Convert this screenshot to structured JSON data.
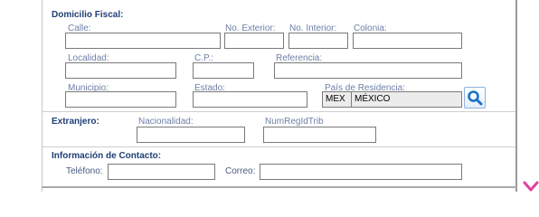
{
  "domicilio_fiscal": {
    "title": "Domicilio Fiscal:",
    "calle_label": "Calle:",
    "calle_value": "",
    "no_exterior_label": "No. Exterior:",
    "no_exterior_value": "",
    "no_interior_label": "No. Interior:",
    "no_interior_value": "",
    "colonia_label": "Colonia:",
    "colonia_value": "",
    "localidad_label": "Localidad:",
    "localidad_value": "",
    "cp_label": "C.P.:",
    "cp_value": "",
    "referencia_label": "Referencia:",
    "referencia_value": "",
    "municipio_label": "Municipio:",
    "municipio_value": "",
    "estado_label": "Estado:",
    "estado_value": "",
    "pais_label": "País de Residencia:",
    "pais_code": "MEX",
    "pais_name": "MÉXICO",
    "search_icon": "search-icon"
  },
  "extranjero": {
    "title": "Extranjero:",
    "nacionalidad_label": "Nacionalidad:",
    "nacionalidad_value": "",
    "numregidtrib_label": "NumRegIdTrib",
    "numregidtrib_value": ""
  },
  "contacto": {
    "title": "Información de Contacto:",
    "telefono_label": "Teléfono:",
    "telefono_value": "",
    "correo_label": "Correo:",
    "correo_value": ""
  },
  "colors": {
    "section_title": "#1f3f77",
    "field_label": "#6d7fa6",
    "search_accent": "#1a73c8",
    "corner_mark": "#e040a0"
  }
}
